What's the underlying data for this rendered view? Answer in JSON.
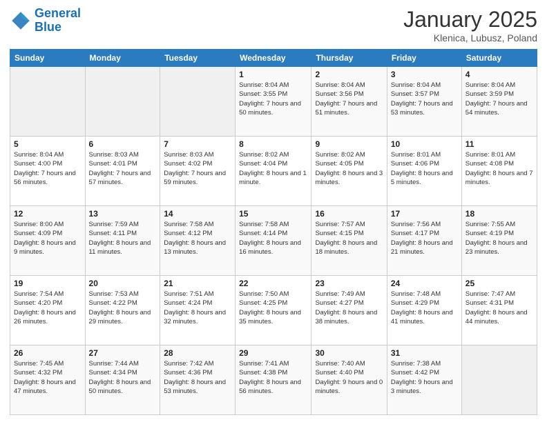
{
  "header": {
    "logo_line1": "General",
    "logo_line2": "Blue",
    "title": "January 2025",
    "subtitle": "Klenica, Lubusz, Poland"
  },
  "weekdays": [
    "Sunday",
    "Monday",
    "Tuesday",
    "Wednesday",
    "Thursday",
    "Friday",
    "Saturday"
  ],
  "weeks": [
    [
      {
        "day": "",
        "info": ""
      },
      {
        "day": "",
        "info": ""
      },
      {
        "day": "",
        "info": ""
      },
      {
        "day": "1",
        "info": "Sunrise: 8:04 AM\nSunset: 3:55 PM\nDaylight: 7 hours and 50 minutes."
      },
      {
        "day": "2",
        "info": "Sunrise: 8:04 AM\nSunset: 3:56 PM\nDaylight: 7 hours and 51 minutes."
      },
      {
        "day": "3",
        "info": "Sunrise: 8:04 AM\nSunset: 3:57 PM\nDaylight: 7 hours and 53 minutes."
      },
      {
        "day": "4",
        "info": "Sunrise: 8:04 AM\nSunset: 3:59 PM\nDaylight: 7 hours and 54 minutes."
      }
    ],
    [
      {
        "day": "5",
        "info": "Sunrise: 8:04 AM\nSunset: 4:00 PM\nDaylight: 7 hours and 56 minutes."
      },
      {
        "day": "6",
        "info": "Sunrise: 8:03 AM\nSunset: 4:01 PM\nDaylight: 7 hours and 57 minutes."
      },
      {
        "day": "7",
        "info": "Sunrise: 8:03 AM\nSunset: 4:02 PM\nDaylight: 7 hours and 59 minutes."
      },
      {
        "day": "8",
        "info": "Sunrise: 8:02 AM\nSunset: 4:04 PM\nDaylight: 8 hours and 1 minute."
      },
      {
        "day": "9",
        "info": "Sunrise: 8:02 AM\nSunset: 4:05 PM\nDaylight: 8 hours and 3 minutes."
      },
      {
        "day": "10",
        "info": "Sunrise: 8:01 AM\nSunset: 4:06 PM\nDaylight: 8 hours and 5 minutes."
      },
      {
        "day": "11",
        "info": "Sunrise: 8:01 AM\nSunset: 4:08 PM\nDaylight: 8 hours and 7 minutes."
      }
    ],
    [
      {
        "day": "12",
        "info": "Sunrise: 8:00 AM\nSunset: 4:09 PM\nDaylight: 8 hours and 9 minutes."
      },
      {
        "day": "13",
        "info": "Sunrise: 7:59 AM\nSunset: 4:11 PM\nDaylight: 8 hours and 11 minutes."
      },
      {
        "day": "14",
        "info": "Sunrise: 7:58 AM\nSunset: 4:12 PM\nDaylight: 8 hours and 13 minutes."
      },
      {
        "day": "15",
        "info": "Sunrise: 7:58 AM\nSunset: 4:14 PM\nDaylight: 8 hours and 16 minutes."
      },
      {
        "day": "16",
        "info": "Sunrise: 7:57 AM\nSunset: 4:15 PM\nDaylight: 8 hours and 18 minutes."
      },
      {
        "day": "17",
        "info": "Sunrise: 7:56 AM\nSunset: 4:17 PM\nDaylight: 8 hours and 21 minutes."
      },
      {
        "day": "18",
        "info": "Sunrise: 7:55 AM\nSunset: 4:19 PM\nDaylight: 8 hours and 23 minutes."
      }
    ],
    [
      {
        "day": "19",
        "info": "Sunrise: 7:54 AM\nSunset: 4:20 PM\nDaylight: 8 hours and 26 minutes."
      },
      {
        "day": "20",
        "info": "Sunrise: 7:53 AM\nSunset: 4:22 PM\nDaylight: 8 hours and 29 minutes."
      },
      {
        "day": "21",
        "info": "Sunrise: 7:51 AM\nSunset: 4:24 PM\nDaylight: 8 hours and 32 minutes."
      },
      {
        "day": "22",
        "info": "Sunrise: 7:50 AM\nSunset: 4:25 PM\nDaylight: 8 hours and 35 minutes."
      },
      {
        "day": "23",
        "info": "Sunrise: 7:49 AM\nSunset: 4:27 PM\nDaylight: 8 hours and 38 minutes."
      },
      {
        "day": "24",
        "info": "Sunrise: 7:48 AM\nSunset: 4:29 PM\nDaylight: 8 hours and 41 minutes."
      },
      {
        "day": "25",
        "info": "Sunrise: 7:47 AM\nSunset: 4:31 PM\nDaylight: 8 hours and 44 minutes."
      }
    ],
    [
      {
        "day": "26",
        "info": "Sunrise: 7:45 AM\nSunset: 4:32 PM\nDaylight: 8 hours and 47 minutes."
      },
      {
        "day": "27",
        "info": "Sunrise: 7:44 AM\nSunset: 4:34 PM\nDaylight: 8 hours and 50 minutes."
      },
      {
        "day": "28",
        "info": "Sunrise: 7:42 AM\nSunset: 4:36 PM\nDaylight: 8 hours and 53 minutes."
      },
      {
        "day": "29",
        "info": "Sunrise: 7:41 AM\nSunset: 4:38 PM\nDaylight: 8 hours and 56 minutes."
      },
      {
        "day": "30",
        "info": "Sunrise: 7:40 AM\nSunset: 4:40 PM\nDaylight: 9 hours and 0 minutes."
      },
      {
        "day": "31",
        "info": "Sunrise: 7:38 AM\nSunset: 4:42 PM\nDaylight: 9 hours and 3 minutes."
      },
      {
        "day": "",
        "info": ""
      }
    ]
  ]
}
